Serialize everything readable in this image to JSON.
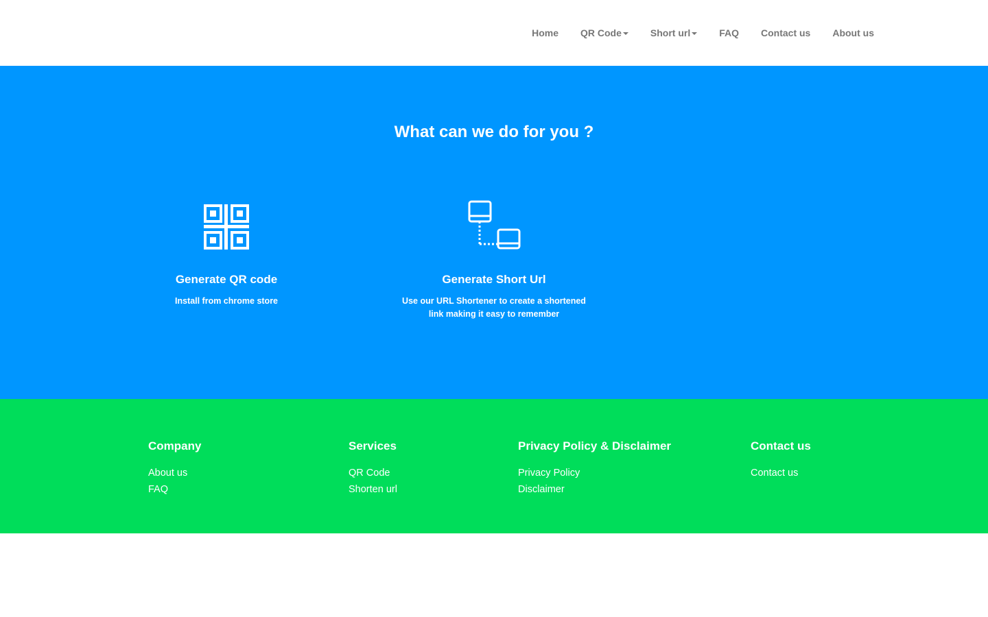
{
  "nav": {
    "items": [
      {
        "label": "Home",
        "dropdown": false
      },
      {
        "label": "QR Code",
        "dropdown": true
      },
      {
        "label": "Short url",
        "dropdown": true
      },
      {
        "label": "FAQ",
        "dropdown": false
      },
      {
        "label": "Contact us",
        "dropdown": false
      },
      {
        "label": "About us",
        "dropdown": false
      }
    ]
  },
  "services": {
    "title": "What can we do for you ?",
    "background": "#0096ff",
    "cards": [
      {
        "icon": "qr-code-icon",
        "title": "Generate QR code",
        "description": "Install from chrome store"
      },
      {
        "icon": "link-devices-icon",
        "title": "Generate Short Url",
        "description": "Use our URL Shortener to create a shortened link making it easy to remember"
      }
    ]
  },
  "footer": {
    "background": "#00dd5a",
    "columns": [
      {
        "heading": "Company",
        "links": [
          "About us",
          "FAQ"
        ]
      },
      {
        "heading": "Services",
        "links": [
          "QR Code",
          "Shorten url"
        ]
      },
      {
        "heading": "Privacy Policy & Disclaimer",
        "links": [
          "Privacy Policy",
          "Disclaimer"
        ]
      },
      {
        "heading": "Contact us",
        "links": [
          "Contact us"
        ]
      }
    ]
  }
}
